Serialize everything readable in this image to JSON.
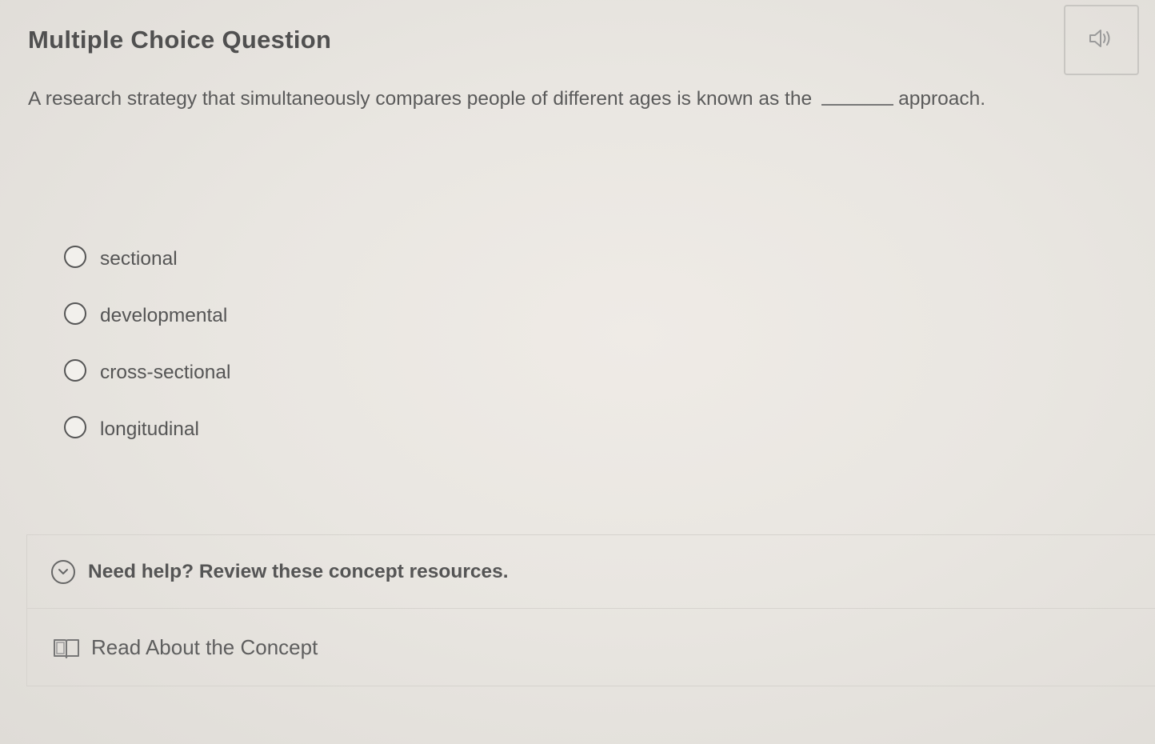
{
  "question": {
    "title": "Multiple Choice Question",
    "text_before": "A research strategy that simultaneously compares people of different ages is known as the",
    "text_after": "approach.",
    "audio_icon": "speaker-icon"
  },
  "options": [
    {
      "label": "sectional",
      "selected": false
    },
    {
      "label": "developmental",
      "selected": false
    },
    {
      "label": "cross-sectional",
      "selected": false
    },
    {
      "label": "longitudinal",
      "selected": false
    }
  ],
  "help": {
    "header": "Need help? Review these concept resources.",
    "header_icon": "chevron-down-circle-icon",
    "resources": [
      {
        "label": "Read About the Concept",
        "icon": "book-icon"
      }
    ]
  }
}
